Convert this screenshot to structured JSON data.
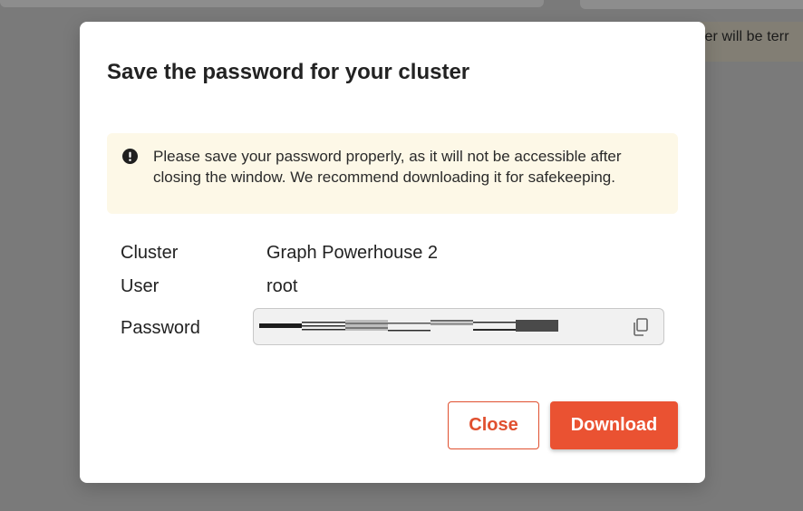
{
  "background": {
    "banner_text": "ter will be terr"
  },
  "modal": {
    "title": "Save the password for your cluster",
    "alert": {
      "icon": "exclamation-circle-icon",
      "text": "Please save your password properly, as it will not be accessible after closing the window. We recommend downloading it for safekeeping."
    },
    "rows": {
      "cluster_label": "Cluster",
      "cluster_value": "Graph Powerhouse 2",
      "user_label": "User",
      "user_value": "root",
      "password_label": "Password"
    },
    "password_field": {
      "copy_icon": "copy-icon"
    },
    "buttons": {
      "close_label": "Close",
      "download_label": "Download"
    }
  },
  "colors": {
    "accent": "#ea5232",
    "alert_background": "#fdf8e7",
    "overlay": "#7a7a7a"
  }
}
